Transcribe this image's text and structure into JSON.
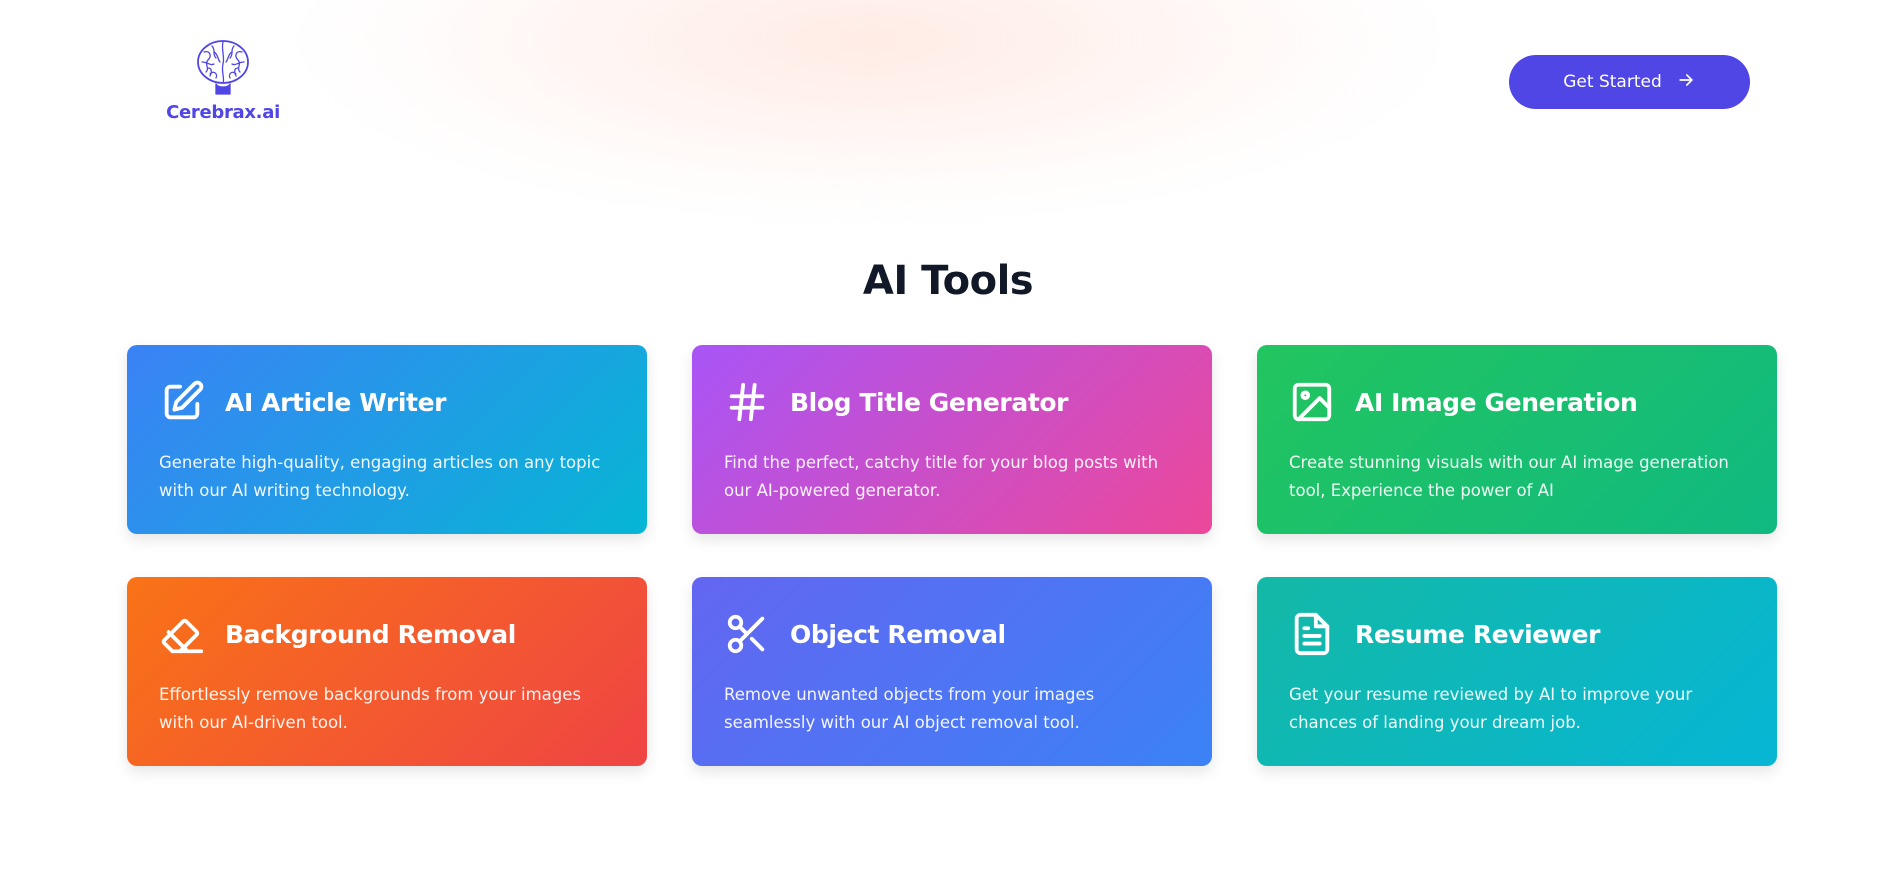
{
  "header": {
    "logo_text": "Cerebrax.ai",
    "logo_icon": "brain-icon",
    "cta_label": "Get Started",
    "cta_icon": "arrow-right-icon",
    "accent_color": "#4f46e5"
  },
  "section": {
    "title": "AI Tools"
  },
  "tools": [
    {
      "title": "AI Article Writer",
      "description": "Generate high-quality, engaging articles on any topic with our AI writing technology.",
      "icon": "edit-icon",
      "gradient": [
        "#3b82f6",
        "#06b6d4"
      ]
    },
    {
      "title": "Blog Title Generator",
      "description": "Find the perfect, catchy title for your blog posts with our AI-powered generator.",
      "icon": "hash-icon",
      "gradient": [
        "#a855f7",
        "#ec4899"
      ]
    },
    {
      "title": "AI Image Generation",
      "description": "Create stunning visuals with our AI image generation tool, Experience the power of AI",
      "icon": "image-icon",
      "gradient": [
        "#22c55e",
        "#10b981"
      ]
    },
    {
      "title": "Background Removal",
      "description": "Effortlessly remove backgrounds from your images with our AI-driven tool.",
      "icon": "eraser-icon",
      "gradient": [
        "#f97316",
        "#ef4444"
      ]
    },
    {
      "title": "Object Removal",
      "description": "Remove unwanted objects from your images seamlessly with our AI object removal tool.",
      "icon": "scissors-icon",
      "gradient": [
        "#6366f1",
        "#3b82f6"
      ]
    },
    {
      "title": "Resume Reviewer",
      "description": "Get your resume reviewed by AI to improve your chances of landing your dream job.",
      "icon": "file-text-icon",
      "gradient": [
        "#14b8a6",
        "#06b6d4"
      ]
    }
  ]
}
